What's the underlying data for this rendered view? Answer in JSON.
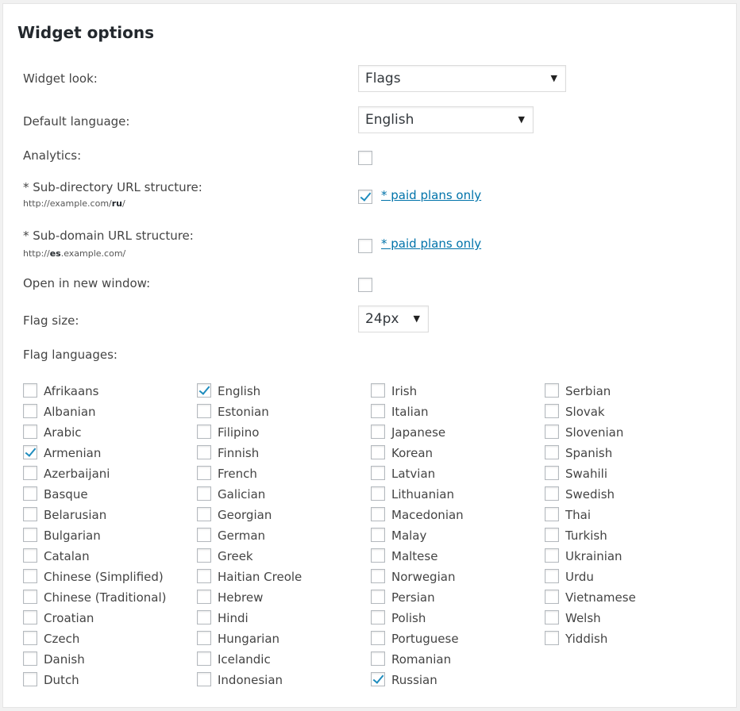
{
  "panel": {
    "title": "Widget options"
  },
  "rows": {
    "widget_look": {
      "label": "Widget look:",
      "value": "Flags"
    },
    "default_language": {
      "label": "Default language:",
      "value": "English"
    },
    "analytics": {
      "label": "Analytics:",
      "checked": false
    },
    "subdirectory": {
      "label": "* Sub-directory URL structure:",
      "example_prefix": "http://example.com/",
      "example_bold": "ru",
      "example_suffix": "/",
      "checked": true,
      "link": "* paid plans only"
    },
    "subdomain": {
      "label": "* Sub-domain URL structure:",
      "example_prefix": "http://",
      "example_bold": "es",
      "example_suffix": ".example.com/",
      "checked": false,
      "link": "* paid plans only"
    },
    "new_window": {
      "label": "Open in new window:",
      "checked": false
    },
    "flag_size": {
      "label": "Flag size:",
      "value": "24px"
    },
    "flag_languages": {
      "label": "Flag languages:"
    }
  },
  "languages": [
    [
      {
        "name": "Afrikaans",
        "checked": false
      },
      {
        "name": "Albanian",
        "checked": false
      },
      {
        "name": "Arabic",
        "checked": false
      },
      {
        "name": "Armenian",
        "checked": true
      },
      {
        "name": "Azerbaijani",
        "checked": false
      },
      {
        "name": "Basque",
        "checked": false
      },
      {
        "name": "Belarusian",
        "checked": false
      },
      {
        "name": "Bulgarian",
        "checked": false
      },
      {
        "name": "Catalan",
        "checked": false
      },
      {
        "name": "Chinese (Simplified)",
        "checked": false
      },
      {
        "name": "Chinese (Traditional)",
        "checked": false
      },
      {
        "name": "Croatian",
        "checked": false
      },
      {
        "name": "Czech",
        "checked": false
      },
      {
        "name": "Danish",
        "checked": false
      },
      {
        "name": "Dutch",
        "checked": false
      }
    ],
    [
      {
        "name": "English",
        "checked": true
      },
      {
        "name": "Estonian",
        "checked": false
      },
      {
        "name": "Filipino",
        "checked": false
      },
      {
        "name": "Finnish",
        "checked": false
      },
      {
        "name": "French",
        "checked": false
      },
      {
        "name": "Galician",
        "checked": false
      },
      {
        "name": "Georgian",
        "checked": false
      },
      {
        "name": "German",
        "checked": false
      },
      {
        "name": "Greek",
        "checked": false
      },
      {
        "name": "Haitian Creole",
        "checked": false
      },
      {
        "name": "Hebrew",
        "checked": false
      },
      {
        "name": "Hindi",
        "checked": false
      },
      {
        "name": "Hungarian",
        "checked": false
      },
      {
        "name": "Icelandic",
        "checked": false
      },
      {
        "name": "Indonesian",
        "checked": false
      }
    ],
    [
      {
        "name": "Irish",
        "checked": false
      },
      {
        "name": "Italian",
        "checked": false
      },
      {
        "name": "Japanese",
        "checked": false
      },
      {
        "name": "Korean",
        "checked": false
      },
      {
        "name": "Latvian",
        "checked": false
      },
      {
        "name": "Lithuanian",
        "checked": false
      },
      {
        "name": "Macedonian",
        "checked": false
      },
      {
        "name": "Malay",
        "checked": false
      },
      {
        "name": "Maltese",
        "checked": false
      },
      {
        "name": "Norwegian",
        "checked": false
      },
      {
        "name": "Persian",
        "checked": false
      },
      {
        "name": "Polish",
        "checked": false
      },
      {
        "name": "Portuguese",
        "checked": false
      },
      {
        "name": "Romanian",
        "checked": false
      },
      {
        "name": "Russian",
        "checked": true
      }
    ],
    [
      {
        "name": "Serbian",
        "checked": false
      },
      {
        "name": "Slovak",
        "checked": false
      },
      {
        "name": "Slovenian",
        "checked": false
      },
      {
        "name": "Spanish",
        "checked": false
      },
      {
        "name": "Swahili",
        "checked": false
      },
      {
        "name": "Swedish",
        "checked": false
      },
      {
        "name": "Thai",
        "checked": false
      },
      {
        "name": "Turkish",
        "checked": false
      },
      {
        "name": "Ukrainian",
        "checked": false
      },
      {
        "name": "Urdu",
        "checked": false
      },
      {
        "name": "Vietnamese",
        "checked": false
      },
      {
        "name": "Welsh",
        "checked": false
      },
      {
        "name": "Yiddish",
        "checked": false
      }
    ]
  ]
}
